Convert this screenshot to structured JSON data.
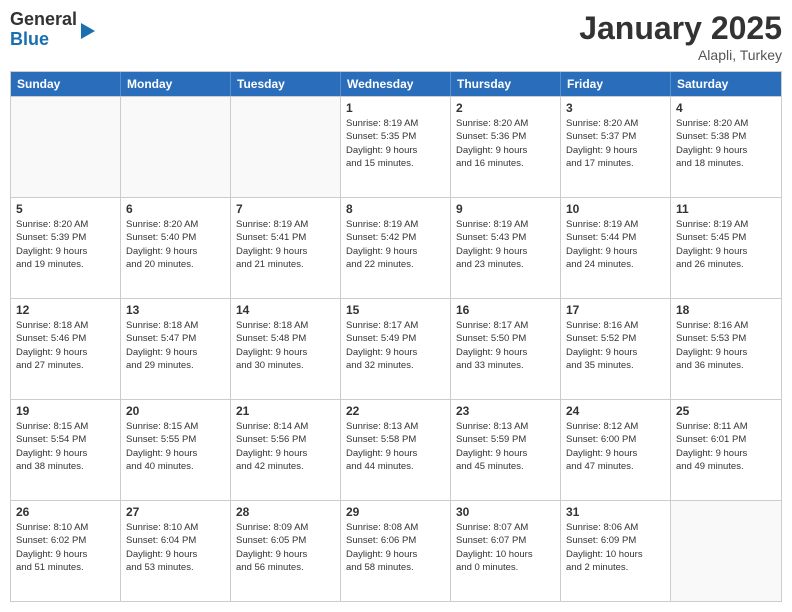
{
  "logo": {
    "general": "General",
    "blue": "Blue"
  },
  "header": {
    "title": "January 2025",
    "subtitle": "Alapli, Turkey"
  },
  "days": [
    "Sunday",
    "Monday",
    "Tuesday",
    "Wednesday",
    "Thursday",
    "Friday",
    "Saturday"
  ],
  "rows": [
    [
      {
        "day": "",
        "empty": true
      },
      {
        "day": "",
        "empty": true
      },
      {
        "day": "",
        "empty": true
      },
      {
        "day": "1",
        "sunrise": "8:19 AM",
        "sunset": "5:35 PM",
        "daylight": "9 hours and 15 minutes."
      },
      {
        "day": "2",
        "sunrise": "8:20 AM",
        "sunset": "5:36 PM",
        "daylight": "9 hours and 16 minutes."
      },
      {
        "day": "3",
        "sunrise": "8:20 AM",
        "sunset": "5:37 PM",
        "daylight": "9 hours and 17 minutes."
      },
      {
        "day": "4",
        "sunrise": "8:20 AM",
        "sunset": "5:38 PM",
        "daylight": "9 hours and 18 minutes."
      }
    ],
    [
      {
        "day": "5",
        "sunrise": "8:20 AM",
        "sunset": "5:39 PM",
        "daylight": "9 hours and 19 minutes."
      },
      {
        "day": "6",
        "sunrise": "8:20 AM",
        "sunset": "5:40 PM",
        "daylight": "9 hours and 20 minutes."
      },
      {
        "day": "7",
        "sunrise": "8:19 AM",
        "sunset": "5:41 PM",
        "daylight": "9 hours and 21 minutes."
      },
      {
        "day": "8",
        "sunrise": "8:19 AM",
        "sunset": "5:42 PM",
        "daylight": "9 hours and 22 minutes."
      },
      {
        "day": "9",
        "sunrise": "8:19 AM",
        "sunset": "5:43 PM",
        "daylight": "9 hours and 23 minutes."
      },
      {
        "day": "10",
        "sunrise": "8:19 AM",
        "sunset": "5:44 PM",
        "daylight": "9 hours and 24 minutes."
      },
      {
        "day": "11",
        "sunrise": "8:19 AM",
        "sunset": "5:45 PM",
        "daylight": "9 hours and 26 minutes."
      }
    ],
    [
      {
        "day": "12",
        "sunrise": "8:18 AM",
        "sunset": "5:46 PM",
        "daylight": "9 hours and 27 minutes."
      },
      {
        "day": "13",
        "sunrise": "8:18 AM",
        "sunset": "5:47 PM",
        "daylight": "9 hours and 29 minutes."
      },
      {
        "day": "14",
        "sunrise": "8:18 AM",
        "sunset": "5:48 PM",
        "daylight": "9 hours and 30 minutes."
      },
      {
        "day": "15",
        "sunrise": "8:17 AM",
        "sunset": "5:49 PM",
        "daylight": "9 hours and 32 minutes."
      },
      {
        "day": "16",
        "sunrise": "8:17 AM",
        "sunset": "5:50 PM",
        "daylight": "9 hours and 33 minutes."
      },
      {
        "day": "17",
        "sunrise": "8:16 AM",
        "sunset": "5:52 PM",
        "daylight": "9 hours and 35 minutes."
      },
      {
        "day": "18",
        "sunrise": "8:16 AM",
        "sunset": "5:53 PM",
        "daylight": "9 hours and 36 minutes."
      }
    ],
    [
      {
        "day": "19",
        "sunrise": "8:15 AM",
        "sunset": "5:54 PM",
        "daylight": "9 hours and 38 minutes."
      },
      {
        "day": "20",
        "sunrise": "8:15 AM",
        "sunset": "5:55 PM",
        "daylight": "9 hours and 40 minutes."
      },
      {
        "day": "21",
        "sunrise": "8:14 AM",
        "sunset": "5:56 PM",
        "daylight": "9 hours and 42 minutes."
      },
      {
        "day": "22",
        "sunrise": "8:13 AM",
        "sunset": "5:58 PM",
        "daylight": "9 hours and 44 minutes."
      },
      {
        "day": "23",
        "sunrise": "8:13 AM",
        "sunset": "5:59 PM",
        "daylight": "9 hours and 45 minutes."
      },
      {
        "day": "24",
        "sunrise": "8:12 AM",
        "sunset": "6:00 PM",
        "daylight": "9 hours and 47 minutes."
      },
      {
        "day": "25",
        "sunrise": "8:11 AM",
        "sunset": "6:01 PM",
        "daylight": "9 hours and 49 minutes."
      }
    ],
    [
      {
        "day": "26",
        "sunrise": "8:10 AM",
        "sunset": "6:02 PM",
        "daylight": "9 hours and 51 minutes."
      },
      {
        "day": "27",
        "sunrise": "8:10 AM",
        "sunset": "6:04 PM",
        "daylight": "9 hours and 53 minutes."
      },
      {
        "day": "28",
        "sunrise": "8:09 AM",
        "sunset": "6:05 PM",
        "daylight": "9 hours and 56 minutes."
      },
      {
        "day": "29",
        "sunrise": "8:08 AM",
        "sunset": "6:06 PM",
        "daylight": "9 hours and 58 minutes."
      },
      {
        "day": "30",
        "sunrise": "8:07 AM",
        "sunset": "6:07 PM",
        "daylight": "10 hours and 0 minutes."
      },
      {
        "day": "31",
        "sunrise": "8:06 AM",
        "sunset": "6:09 PM",
        "daylight": "10 hours and 2 minutes."
      },
      {
        "day": "",
        "empty": true
      }
    ]
  ]
}
